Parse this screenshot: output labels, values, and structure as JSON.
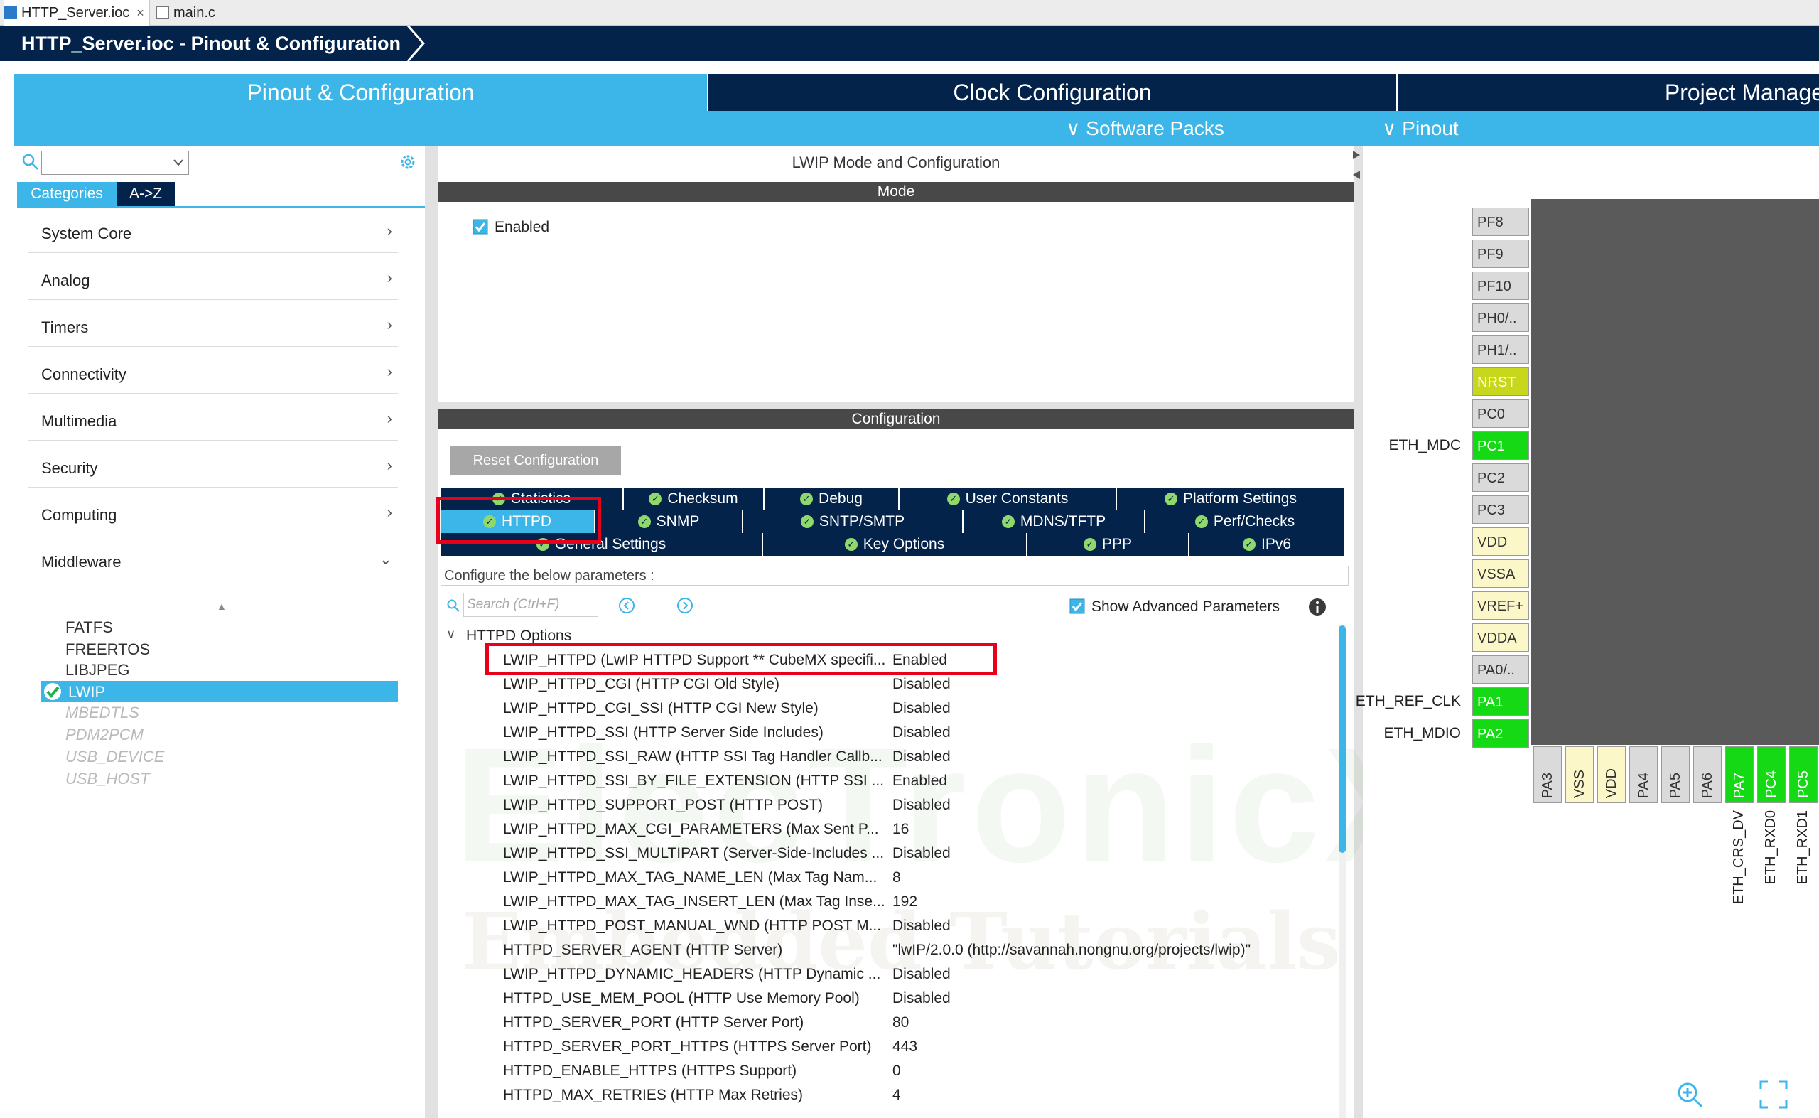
{
  "file_tabs": [
    {
      "label": "HTTP_Server.ioc",
      "close": "×"
    },
    {
      "label": "main.c"
    }
  ],
  "breadcrumb": "HTTP_Server.ioc - Pinout & Configuration",
  "main_tabs": [
    "Pinout & Configuration",
    "Clock Configuration",
    "Project Manage"
  ],
  "subbar": {
    "software_packs": "∨ Software Packs",
    "pinout": "∨ Pinout"
  },
  "left": {
    "category_tabs": [
      "Categories",
      "A->Z"
    ],
    "categories": [
      "System Core",
      "Analog",
      "Timers",
      "Connectivity",
      "Multimedia",
      "Security",
      "Computing",
      "Middleware"
    ],
    "chevron_right": "›",
    "chevron_down": "⌄",
    "middleware_items": [
      {
        "label": "FATFS",
        "disabled": false
      },
      {
        "label": "FREERTOS",
        "disabled": false
      },
      {
        "label": "LIBJPEG",
        "disabled": false
      },
      {
        "label": "LWIP",
        "disabled": false,
        "selected": true
      },
      {
        "label": "MBEDTLS",
        "disabled": true
      },
      {
        "label": "PDM2PCM",
        "disabled": true
      },
      {
        "label": "USB_DEVICE",
        "disabled": true
      },
      {
        "label": "USB_HOST",
        "disabled": true
      }
    ]
  },
  "center": {
    "title": "LWIP Mode and Configuration",
    "mode_header": "Mode",
    "enabled_label": "Enabled",
    "config_header": "Configuration",
    "reset_button": "Reset Configuration",
    "config_tabs_row1": [
      "Statistics",
      "Checksum",
      "Debug",
      "User Constants",
      "Platform Settings"
    ],
    "config_tabs_row2": [
      "HTTPD",
      "SNMP",
      "SNTP/SMTP",
      "MDNS/TFTP",
      "Perf/Checks"
    ],
    "config_tabs_row3": [
      "General Settings",
      "Key Options",
      "PPP",
      "IPv6"
    ],
    "configure_text": "Configure the below parameters :",
    "search_placeholder": "Search (Ctrl+F)",
    "show_advanced": "Show Advanced Parameters",
    "tree_header": "HTTPD Options",
    "params": [
      {
        "name": "LWIP_HTTPD (LwIP HTTPD Support ** CubeMX specifi...",
        "value": "Enabled"
      },
      {
        "name": "LWIP_HTTPD_CGI (HTTP CGI Old Style)",
        "value": "Disabled"
      },
      {
        "name": "LWIP_HTTPD_CGI_SSI (HTTP CGI New Style)",
        "value": "Disabled"
      },
      {
        "name": "LWIP_HTTPD_SSI (HTTP Server Side Includes)",
        "value": "Disabled"
      },
      {
        "name": "LWIP_HTTPD_SSI_RAW (HTTP SSI Tag Handler Callb...",
        "value": "Disabled"
      },
      {
        "name": "LWIP_HTTPD_SSI_BY_FILE_EXTENSION (HTTP SSI ...",
        "value": "Enabled"
      },
      {
        "name": "LWIP_HTTPD_SUPPORT_POST (HTTP POST)",
        "value": "Disabled"
      },
      {
        "name": "LWIP_HTTPD_MAX_CGI_PARAMETERS (Max Sent P...",
        "value": "16"
      },
      {
        "name": "LWIP_HTTPD_SSI_MULTIPART (Server-Side-Includes ...",
        "value": "Disabled"
      },
      {
        "name": "LWIP_HTTPD_MAX_TAG_NAME_LEN (Max Tag Nam...",
        "value": "8"
      },
      {
        "name": "LWIP_HTTPD_MAX_TAG_INSERT_LEN (Max Tag Inse...",
        "value": "192"
      },
      {
        "name": "LWIP_HTTPD_POST_MANUAL_WND (HTTP POST M...",
        "value": "Disabled"
      },
      {
        "name": "HTTPD_SERVER_AGENT (HTTP Server)",
        "value": "\"lwIP/2.0.0 (http://savannah.nongnu.org/projects/lwip)\""
      },
      {
        "name": "LWIP_HTTPD_DYNAMIC_HEADERS (HTTP Dynamic ...",
        "value": "Disabled"
      },
      {
        "name": "HTTPD_USE_MEM_POOL (HTTP Use Memory Pool)",
        "value": "Disabled"
      },
      {
        "name": "HTTPD_SERVER_PORT (HTTP Server Port)",
        "value": "80"
      },
      {
        "name": "HTTPD_SERVER_PORT_HTTPS (HTTPS Server Port)",
        "value": "443"
      },
      {
        "name": "HTTPD_ENABLE_HTTPS (HTTPS Support)",
        "value": "0"
      },
      {
        "name": "HTTPD_MAX_RETRIES (HTTP Max Retries)",
        "value": "4"
      }
    ]
  },
  "pinout": {
    "left_pins": [
      {
        "label": "PF8",
        "color": "gray"
      },
      {
        "label": "PF9",
        "color": "gray"
      },
      {
        "label": "PF10",
        "color": "gray"
      },
      {
        "label": "PH0/..",
        "color": "gray"
      },
      {
        "label": "PH1/..",
        "color": "gray"
      },
      {
        "label": "NRST",
        "color": "nrst"
      },
      {
        "label": "PC0",
        "color": "gray"
      },
      {
        "label": "PC1",
        "color": "green",
        "signal": "ETH_MDC"
      },
      {
        "label": "PC2",
        "color": "gray"
      },
      {
        "label": "PC3",
        "color": "gray"
      },
      {
        "label": "VDD",
        "color": "yellow"
      },
      {
        "label": "VSSA",
        "color": "yellow"
      },
      {
        "label": "VREF+",
        "color": "yellow"
      },
      {
        "label": "VDDA",
        "color": "yellow"
      },
      {
        "label": "PA0/..",
        "color": "gray"
      },
      {
        "label": "PA1",
        "color": "green",
        "signal": "ETH_REF_CLK"
      },
      {
        "label": "PA2",
        "color": "green",
        "signal": "ETH_MDIO"
      }
    ],
    "bottom_pins": [
      {
        "label": "PA3",
        "color": "gray"
      },
      {
        "label": "VSS",
        "color": "yellow"
      },
      {
        "label": "VDD",
        "color": "yellow"
      },
      {
        "label": "PA4",
        "color": "gray"
      },
      {
        "label": "PA5",
        "color": "gray"
      },
      {
        "label": "PA6",
        "color": "gray"
      },
      {
        "label": "PA7",
        "color": "green",
        "signal": "ETH_CRS_DV"
      },
      {
        "label": "PC4",
        "color": "green",
        "signal": "ETH_RXD0"
      },
      {
        "label": "PC5",
        "color": "green",
        "signal": "ETH_RXD1"
      }
    ]
  },
  "watermark": {
    "line1": "ElecTronicX",
    "line2": "Embedded Tutorials Zone"
  },
  "colors": {
    "navy": "#03234b",
    "accent": "#3cb5e8",
    "highlight": "#e8001a",
    "pin_green": "#16d916",
    "pin_yellow": "#fbf7c8"
  }
}
